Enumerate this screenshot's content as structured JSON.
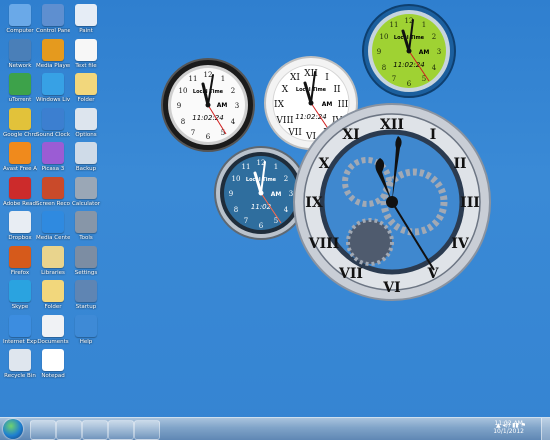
{
  "desktop_icons": [
    {
      "label": "Computer",
      "color": "#6aa9e8"
    },
    {
      "label": "Network",
      "color": "#4a7fb8"
    },
    {
      "label": "uTorrent",
      "color": "#3da24a"
    },
    {
      "label": "Google Chrome",
      "color": "#e2c23a"
    },
    {
      "label": "Avast Free Antivirus",
      "color": "#f08a1c"
    },
    {
      "label": "Adobe Reader",
      "color": "#cc2b2b"
    },
    {
      "label": "Dropbox",
      "color": "#e8edf3"
    },
    {
      "label": "Firefox",
      "color": "#d65a1b"
    },
    {
      "label": "Skype",
      "color": "#2aa3e0"
    },
    {
      "label": "Internet Explorer",
      "color": "#3c8de0"
    },
    {
      "label": "Recycle Bin",
      "color": "#dfe6ee"
    },
    {
      "label": "Control Panel",
      "color": "#5e8fd0"
    },
    {
      "label": "Media Player",
      "color": "#e59a1e"
    },
    {
      "label": "Windows Live",
      "color": "#37a1e5"
    },
    {
      "label": "Sound Clock",
      "color": "#3c7fd0"
    },
    {
      "label": "Picasa 3",
      "color": "#9b5cd4"
    },
    {
      "label": "Screen Recorder",
      "color": "#c94a2a"
    },
    {
      "label": "Media Center",
      "color": "#2f8ae0"
    },
    {
      "label": "Libraries",
      "color": "#e9d48d"
    },
    {
      "label": "Folder",
      "color": "#f2d77c"
    },
    {
      "label": "Documents",
      "color": "#f0f2f5"
    },
    {
      "label": "Notepad",
      "color": "#ffffff"
    },
    {
      "label": "Paint",
      "color": "#e6edf6"
    },
    {
      "label": "Text file",
      "color": "#f7f7f7"
    },
    {
      "label": "Folder",
      "color": "#f2d77c"
    },
    {
      "label": "Options",
      "color": "#dde5ee"
    },
    {
      "label": "Backup",
      "color": "#cfdbe8"
    },
    {
      "label": "Calculator",
      "color": "#9aa7b6"
    },
    {
      "label": "Tools",
      "color": "#8796a8"
    },
    {
      "label": "Settings",
      "color": "#7c8da3"
    },
    {
      "label": "Startup",
      "color": "#5f85b3"
    },
    {
      "label": "Help",
      "color": "#3e8ad6"
    }
  ],
  "gadgets": {
    "brand": "Local Time",
    "ampm": "AM",
    "time_digital": "11:02:24",
    "time_short": "11:02",
    "hour": 11,
    "minute": 2,
    "second": 24
  },
  "taskbar": {
    "start_label": "Start",
    "time": "11:02 AM",
    "date": "10/1/2012"
  }
}
